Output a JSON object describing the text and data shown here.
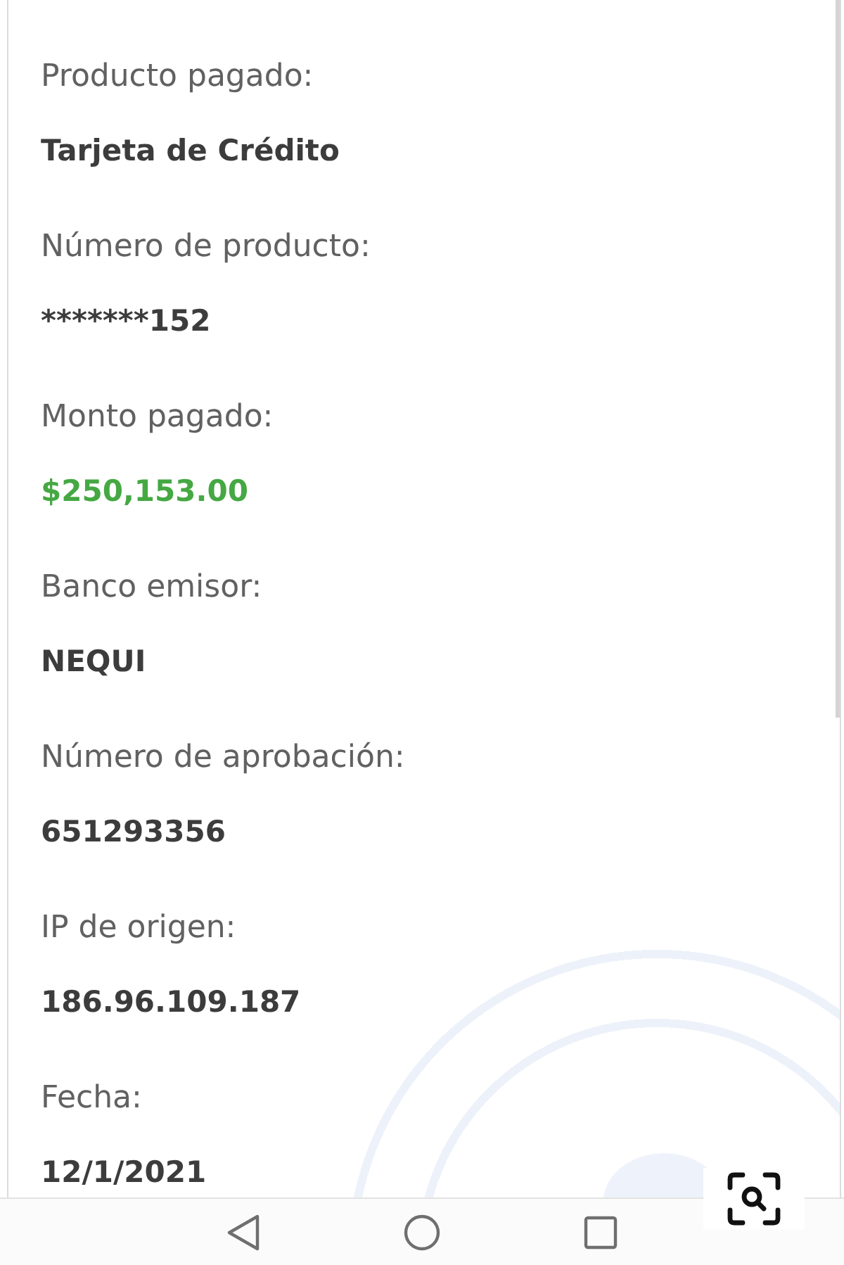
{
  "fields": [
    {
      "label": "Producto pagado:",
      "value": "Tarjeta de Crédito",
      "kind": "text"
    },
    {
      "label": "Número de producto:",
      "value": "*******152",
      "kind": "text"
    },
    {
      "label": "Monto pagado:",
      "value": "$250,153.00",
      "kind": "amount"
    },
    {
      "label": "Banco emisor:",
      "value": "NEQUI",
      "kind": "text"
    },
    {
      "label": "Número de aprobación:",
      "value": "651293356",
      "kind": "text"
    },
    {
      "label": "IP de origen:",
      "value": "186.96.109.187",
      "kind": "text"
    },
    {
      "label": "Fecha:",
      "value": "12/1/2021",
      "kind": "text"
    }
  ]
}
